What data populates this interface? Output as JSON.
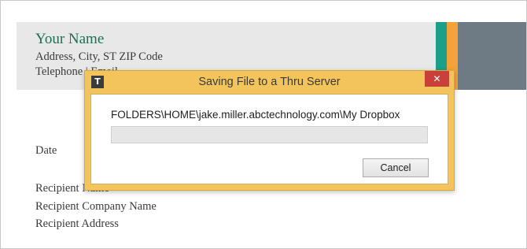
{
  "document": {
    "name": "Your Name",
    "address": "Address, City, ST ZIP Code",
    "telephone": "Telephone | Email",
    "date": "Date",
    "recipient": "Recipient Name",
    "recipient_company": "Recipient Company Name",
    "recipient_address": "Recipient Address",
    "accent_colors": [
      "#1aa088",
      "#f4a13a",
      "#6f7b84"
    ]
  },
  "dialog": {
    "icon": "T",
    "title": "Saving File to a Thru Server",
    "close_icon": "✕",
    "path": "FOLDERS\\HOME\\jake.miller.abctechnology.com\\My Dropbox",
    "progress": 0,
    "cancel_label": "Cancel",
    "frame_color": "#f3c45b"
  }
}
